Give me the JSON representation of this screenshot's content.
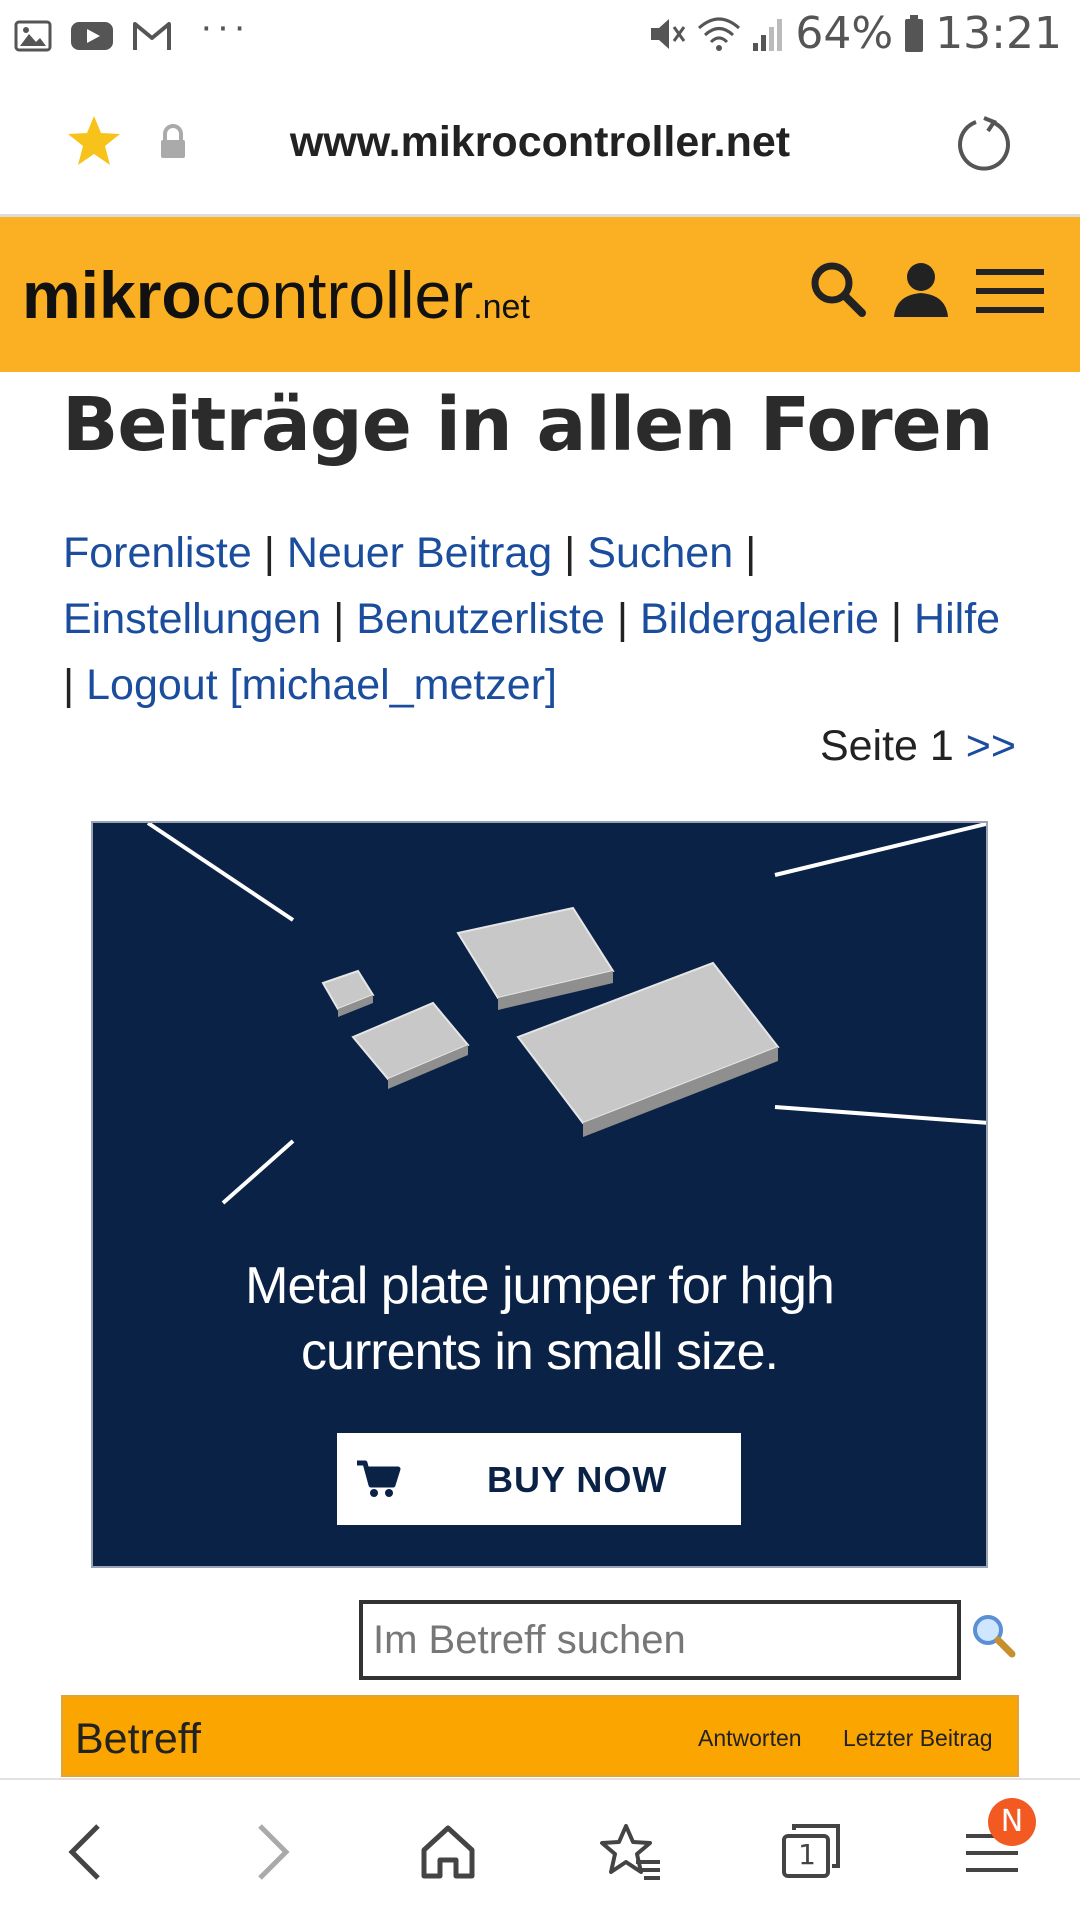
{
  "status_bar": {
    "battery_percent": "64%",
    "time": "13:21",
    "more": "···"
  },
  "browser": {
    "url": "www.mikrocontroller.net"
  },
  "site": {
    "logo_bold": "mikro",
    "logo_regular": "controller",
    "logo_suffix": ".net",
    "accent_color": "#fab022"
  },
  "page": {
    "title": "Beiträge in allen Foren",
    "nav": {
      "forenliste": "Forenliste",
      "neuer_beitrag": "Neuer Beitrag",
      "suchen": "Suchen",
      "einstellungen": "Einstellungen",
      "benutzerliste": "Benutzerliste",
      "bildergalerie": "Bildergalerie",
      "hilfe": "Hilfe",
      "logout": "Logout [michael_metzer]",
      "separator": "|"
    },
    "pagination": {
      "label": "Seite 1",
      "next": ">>"
    }
  },
  "ad": {
    "line1": "Metal plate jumper for high",
    "line2": "currents in small size.",
    "button_label": "BUY NOW"
  },
  "search": {
    "placeholder": "Im Betreff suchen"
  },
  "table": {
    "columns": {
      "subject": "Betreff",
      "replies": "Antworten",
      "last_post": "Letzter Beitrag"
    }
  },
  "bottom_nav": {
    "tabs_count": "1",
    "menu_badge": "N"
  }
}
